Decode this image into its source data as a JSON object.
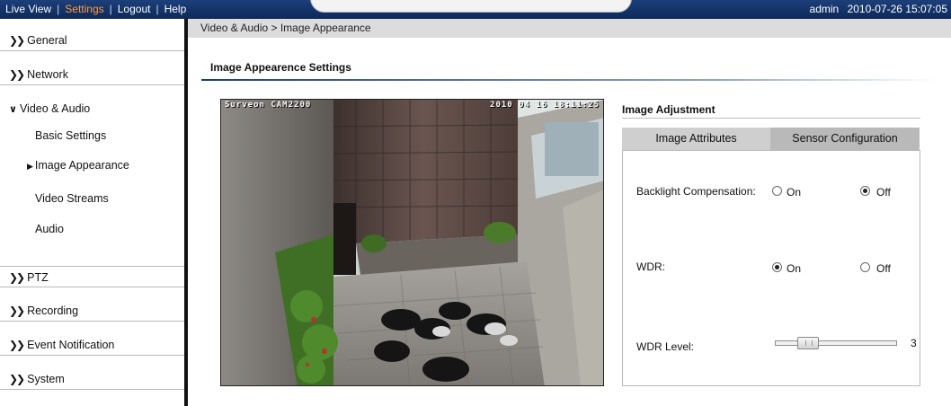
{
  "topbar": {
    "nav": [
      "Live View",
      "Settings",
      "Logout",
      "Help"
    ],
    "separator": "|",
    "active": "Settings",
    "user": "admin",
    "datetime": "2010-07-26 15:07:05",
    "active_color": "#ff9a3c"
  },
  "sidebar": {
    "sections": [
      {
        "label": "General",
        "icon": "double-chevron-right-icon"
      },
      {
        "label": "Network",
        "icon": "double-chevron-right-icon"
      },
      {
        "label": "Video & Audio",
        "icon": "double-chevron-down-icon",
        "expanded": true
      },
      {
        "label": "PTZ",
        "icon": "double-chevron-right-icon"
      },
      {
        "label": "Recording",
        "icon": "double-chevron-right-icon"
      },
      {
        "label": "Event Notification",
        "icon": "double-chevron-right-icon"
      },
      {
        "label": "System",
        "icon": "double-chevron-right-icon"
      }
    ],
    "subitems": [
      "Basic Settings",
      "Image Appearance",
      "Video Streams",
      "Audio"
    ],
    "current_subitem": "Image Appearance"
  },
  "breadcrumb": "Video & Audio > Image Appearance",
  "page_title": "Image Appearence Settings",
  "preview": {
    "osd_left": "Surveon CAM2200",
    "osd_right": "2010 04 16  18:11:25"
  },
  "adjustment": {
    "title": "Image Adjustment",
    "tabs": [
      "Image Attributes",
      "Sensor Configuration"
    ],
    "active_tab": "Image Attributes",
    "backlight": {
      "label": "Backlight Compensation:",
      "on": "On",
      "off": "Off",
      "selected": "Off"
    },
    "wdr": {
      "label": "WDR:",
      "on": "On",
      "off": "Off",
      "selected": "On"
    },
    "wdr_level": {
      "label": "WDR Level:",
      "value": "3",
      "min": 1,
      "max": 10
    }
  }
}
